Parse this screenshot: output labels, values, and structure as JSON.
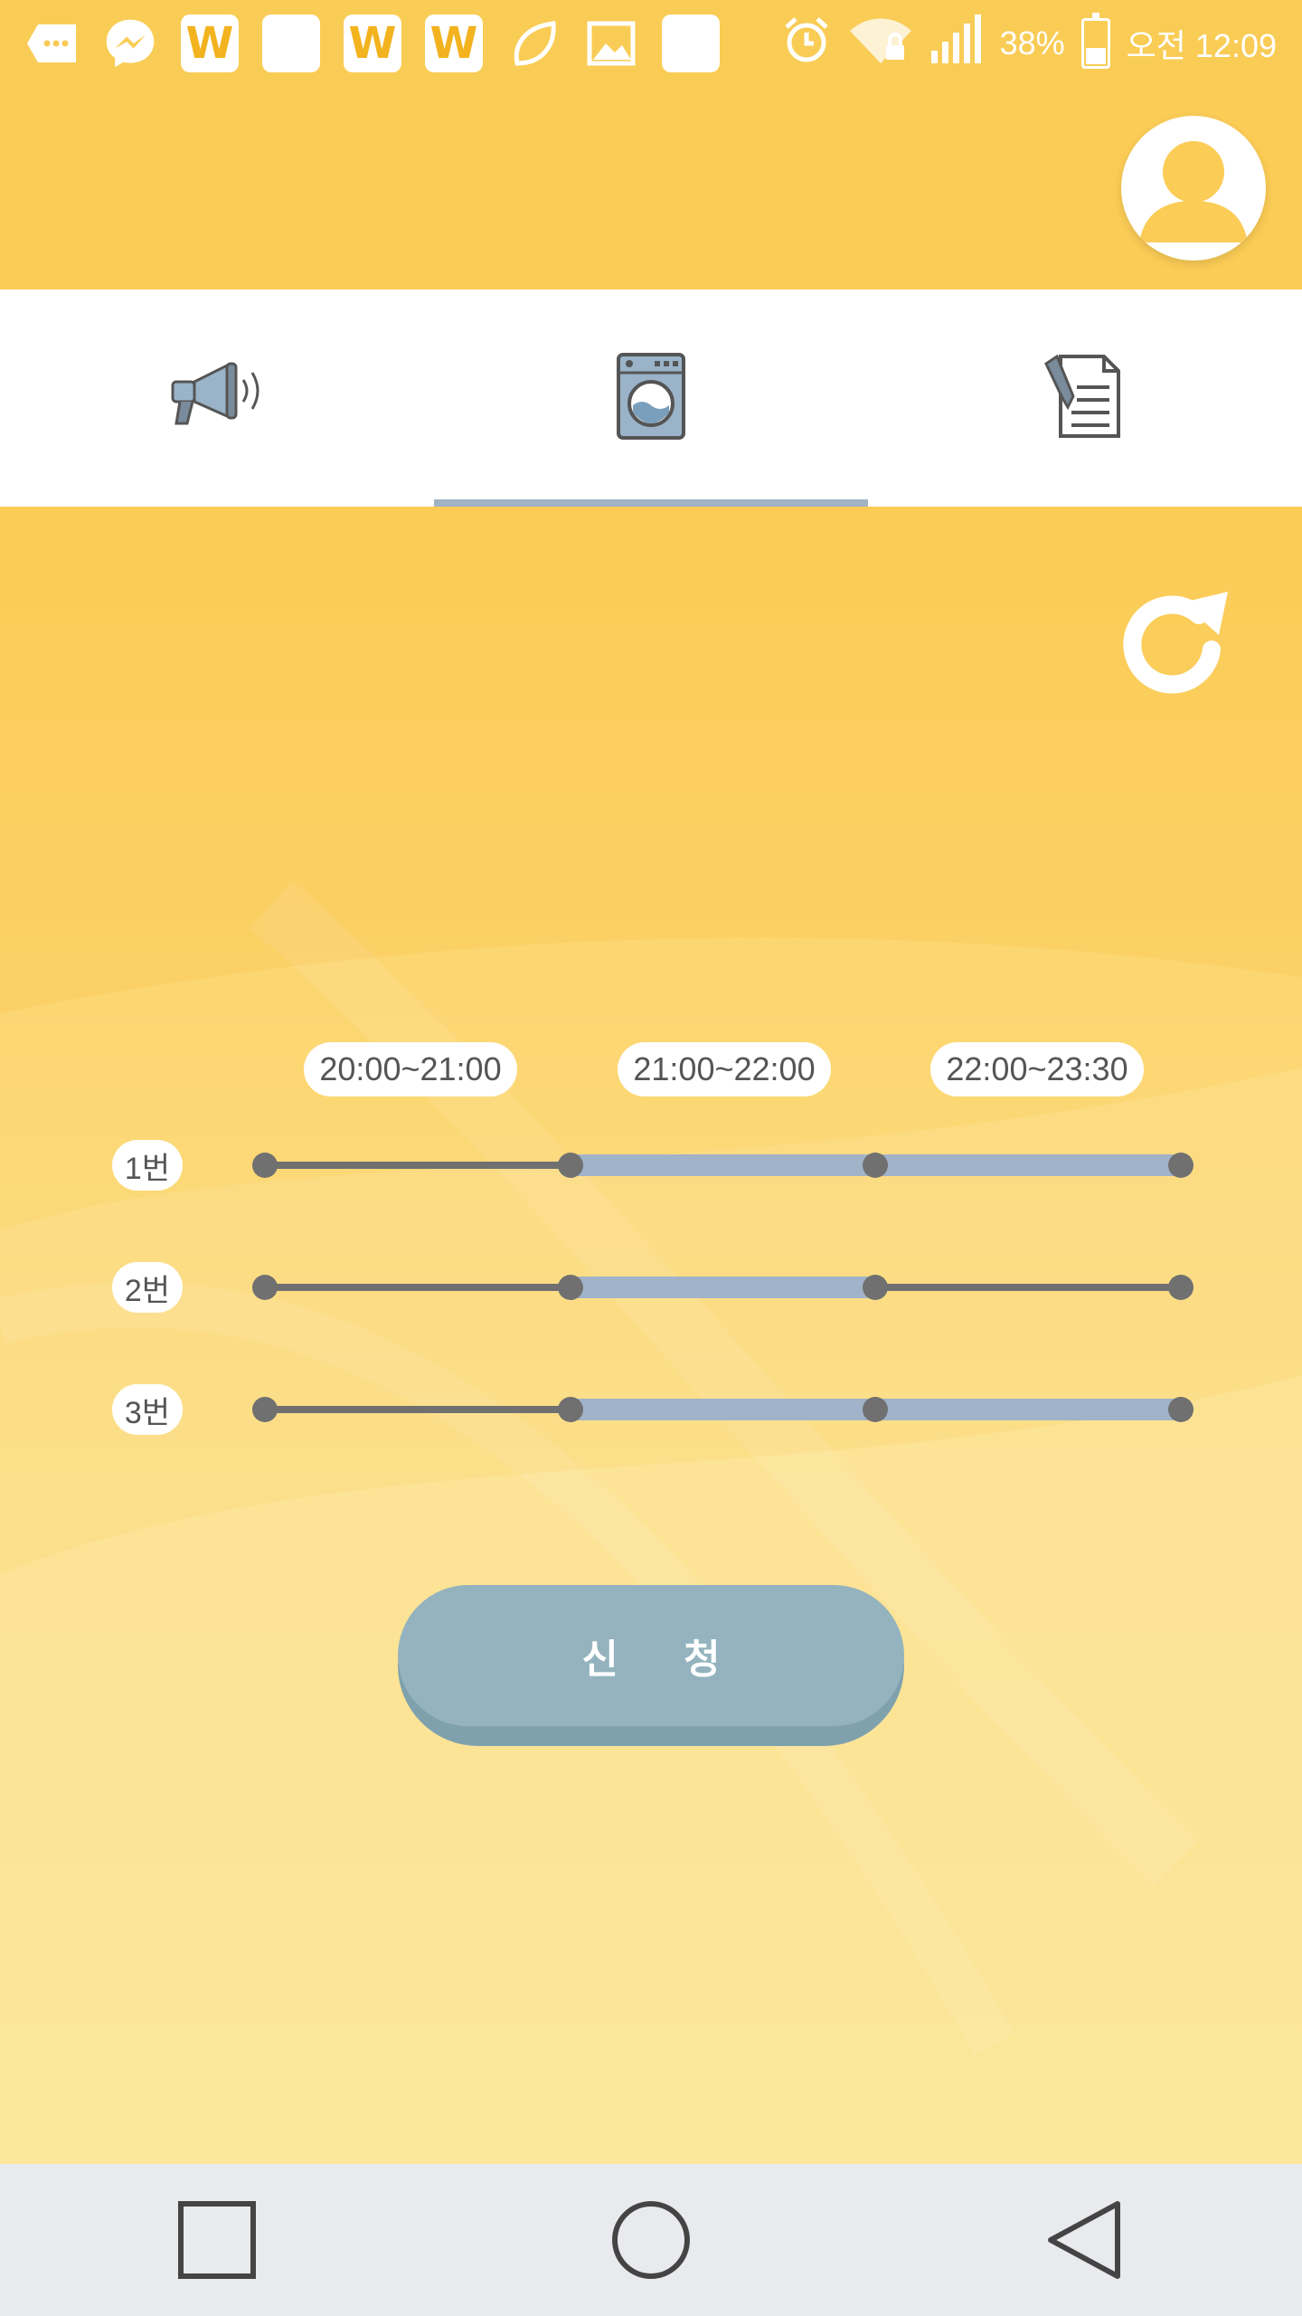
{
  "status_bar": {
    "notification_icons": [
      "overflow-icon",
      "messenger-icon",
      "w-icon",
      "blank-icon",
      "w-icon",
      "w-icon",
      "leaf-icon",
      "gallery-icon",
      "blank-icon"
    ],
    "w_letter": "W",
    "battery_percent": "38%",
    "time": "오전 12:09"
  },
  "header": {
    "avatar_icon": "user-avatar-icon"
  },
  "tabs": [
    {
      "icon": "megaphone-icon",
      "selected": false
    },
    {
      "icon": "washing-machine-icon",
      "selected": true
    },
    {
      "icon": "document-icon",
      "selected": false
    }
  ],
  "reservation": {
    "time_slots": [
      "20:00~21:00",
      "21:00~22:00",
      "22:00~23:30"
    ],
    "machines": [
      {
        "label": "1번",
        "slots_reserved": [
          false,
          true,
          true
        ]
      },
      {
        "label": "2번",
        "slots_reserved": [
          false,
          true,
          false
        ]
      },
      {
        "label": "3번",
        "slots_reserved": [
          false,
          true,
          true
        ]
      }
    ],
    "apply_label": "신 청"
  },
  "colors": {
    "status_bar": "#f9cc55",
    "header": "#fbcc56",
    "reserved_segment": "#a1b3c9",
    "free_segment": "#707070",
    "node": "#707070",
    "tab_indicator": "#a1b3c4",
    "apply_button": "#94b3bf"
  },
  "nav": {
    "recent_icon": "square-icon",
    "home_icon": "circle-icon",
    "back_icon": "triangle-back-icon"
  }
}
